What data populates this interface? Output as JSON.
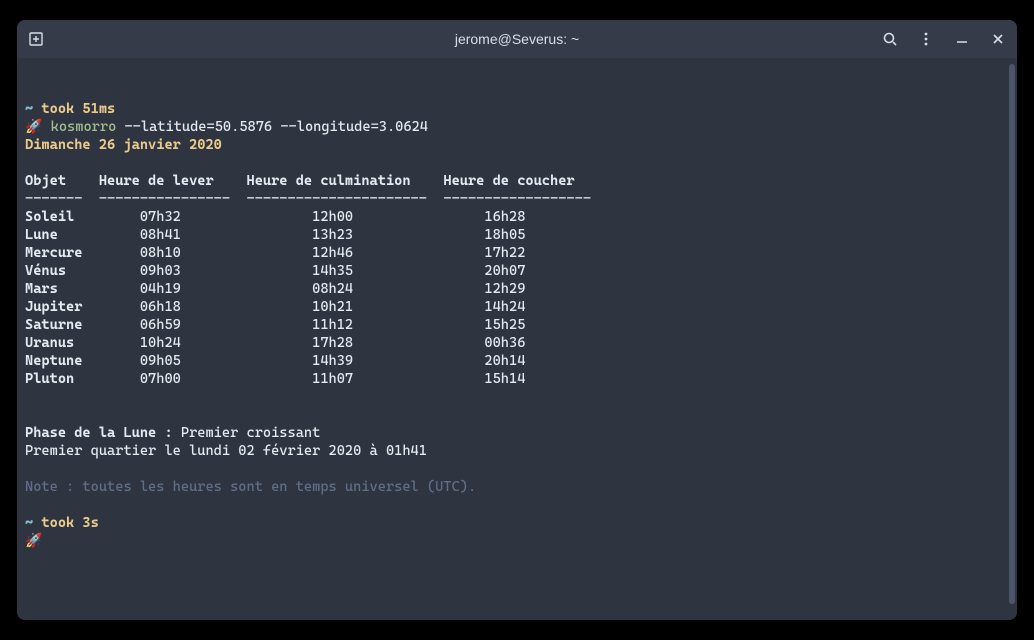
{
  "window": {
    "title": "jerome@Severus: ~"
  },
  "prompt1": {
    "tilde": "~",
    "took_label": "took",
    "took_value": "51ms",
    "rocket": "🚀",
    "command_name": "kosmorro",
    "command_args": " --latitude=50.5876 --longitude=3.0624"
  },
  "date_heading": "Dimanche 26 janvier 2020",
  "table": {
    "headers": {
      "object": "Objet",
      "rise": "Heure de lever",
      "culmination": "Heure de culmination",
      "set": "Heure de coucher"
    },
    "separator": {
      "c1": "-------",
      "c2": "----------------",
      "c3": "----------------------",
      "c4": "------------------"
    },
    "rows": [
      {
        "name": "Soleil",
        "rise": "07h32",
        "culm": "12h00",
        "set": "16h28"
      },
      {
        "name": "Lune",
        "rise": "08h41",
        "culm": "13h23",
        "set": "18h05"
      },
      {
        "name": "Mercure",
        "rise": "08h10",
        "culm": "12h46",
        "set": "17h22"
      },
      {
        "name": "Vénus",
        "rise": "09h03",
        "culm": "14h35",
        "set": "20h07"
      },
      {
        "name": "Mars",
        "rise": "04h19",
        "culm": "08h24",
        "set": "12h29"
      },
      {
        "name": "Jupiter",
        "rise": "06h18",
        "culm": "10h21",
        "set": "14h24"
      },
      {
        "name": "Saturne",
        "rise": "06h59",
        "culm": "11h12",
        "set": "15h25"
      },
      {
        "name": "Uranus",
        "rise": "10h24",
        "culm": "17h28",
        "set": "00h36"
      },
      {
        "name": "Neptune",
        "rise": "09h05",
        "culm": "14h39",
        "set": "20h14"
      },
      {
        "name": "Pluton",
        "rise": "07h00",
        "culm": "11h07",
        "set": "15h14"
      }
    ]
  },
  "moon": {
    "phase_label": "Phase de la Lune : ",
    "phase_value": "Premier croissant",
    "next_quarter": "Premier quartier le lundi 02 février 2020 à 01h41"
  },
  "note": "Note : toutes les heures sont en temps universel (UTC).",
  "prompt2": {
    "tilde": "~",
    "took_label": "took",
    "took_value": "3s",
    "rocket": "🚀"
  }
}
